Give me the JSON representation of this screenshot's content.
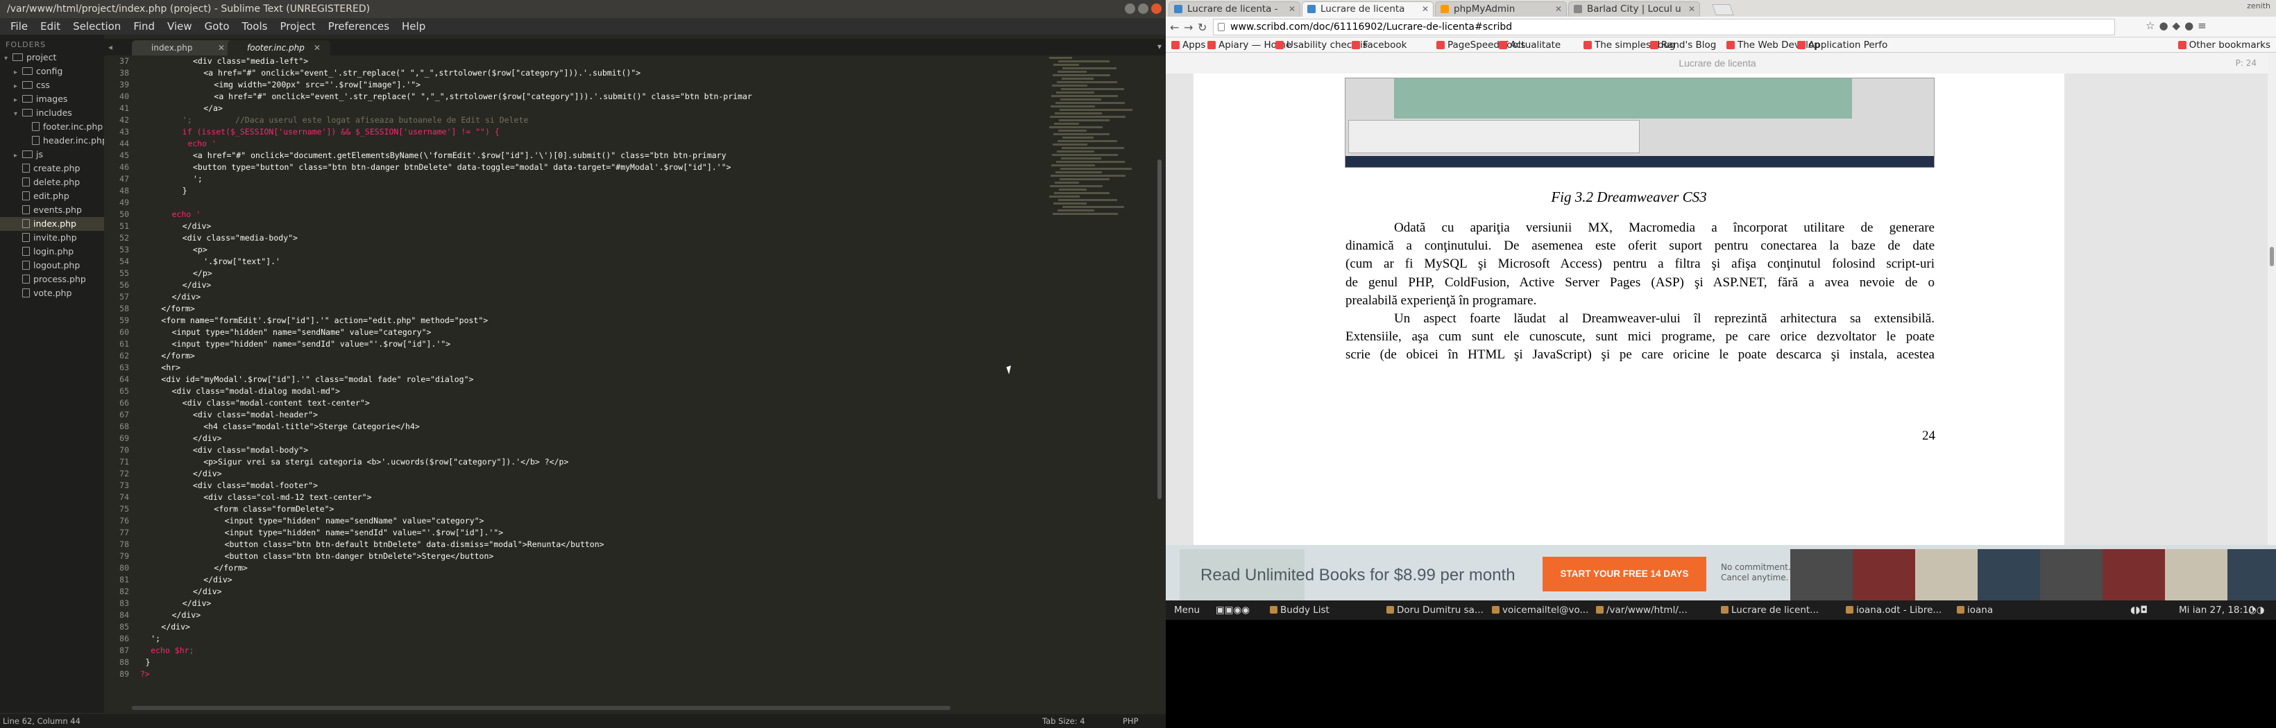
{
  "sublime": {
    "title": "/var/www/html/project/index.php (project) - Sublime Text (UNREGISTERED)",
    "menu": [
      "File",
      "Edit",
      "Selection",
      "Find",
      "View",
      "Goto",
      "Tools",
      "Project",
      "Preferences",
      "Help"
    ],
    "sidebar": {
      "header": "FOLDERS",
      "tree": [
        {
          "label": "project",
          "kind": "folder",
          "depth": 0,
          "open": true
        },
        {
          "label": "config",
          "kind": "folder",
          "depth": 1,
          "open": false
        },
        {
          "label": "css",
          "kind": "folder",
          "depth": 1,
          "open": false
        },
        {
          "label": "images",
          "kind": "folder",
          "depth": 1,
          "open": false
        },
        {
          "label": "includes",
          "kind": "folder",
          "depth": 1,
          "open": true
        },
        {
          "label": "footer.inc.php",
          "kind": "file",
          "depth": 2
        },
        {
          "label": "header.inc.php",
          "kind": "file",
          "depth": 2
        },
        {
          "label": "js",
          "kind": "folder",
          "depth": 1,
          "open": false
        },
        {
          "label": "create.php",
          "kind": "file",
          "depth": 1
        },
        {
          "label": "delete.php",
          "kind": "file",
          "depth": 1
        },
        {
          "label": "edit.php",
          "kind": "file",
          "depth": 1
        },
        {
          "label": "events.php",
          "kind": "file",
          "depth": 1
        },
        {
          "label": "index.php",
          "kind": "file",
          "depth": 1,
          "active": true
        },
        {
          "label": "invite.php",
          "kind": "file",
          "depth": 1
        },
        {
          "label": "login.php",
          "kind": "file",
          "depth": 1
        },
        {
          "label": "logout.php",
          "kind": "file",
          "depth": 1
        },
        {
          "label": "process.php",
          "kind": "file",
          "depth": 1
        },
        {
          "label": "vote.php",
          "kind": "file",
          "depth": 1
        }
      ]
    },
    "tabs": [
      {
        "label": "index.php",
        "active": false
      },
      {
        "label": "footer.inc.php",
        "active": true
      }
    ],
    "code": [
      {
        "n": "37",
        "indent": 10,
        "t": "<div class=\"media-left\">",
        "c": "tag"
      },
      {
        "n": "38",
        "indent": 12,
        "t": "<a href=\"#\" onclick=\"event_'.str_replace(\" \",\"_\",strtolower($row[\"category\"])).'.submit()\">",
        "c": "tag"
      },
      {
        "n": "39",
        "indent": 14,
        "t": "<img width=\"200px\" src=\"'.$row[\"image\"].'\">",
        "c": "tag"
      },
      {
        "n": "40",
        "indent": 14,
        "t": "<a href=\"#\" onclick=\"event_'.str_replace(\" \",\"_\",strtolower($row[\"category\"])).'.submit()\" class=\"btn btn-primar",
        "c": "tag"
      },
      {
        "n": "41",
        "indent": 12,
        "t": "</a>",
        "c": "tag"
      },
      {
        "n": "42",
        "indent": 8,
        "t": "';         //Daca userul este logat afiseaza butoanele de Edit si Delete",
        "c": "cmt"
      },
      {
        "n": "43",
        "indent": 8,
        "t": "if (isset($_SESSION['username']) && $_SESSION['username'] != \"\") {",
        "c": "kw"
      },
      {
        "n": "44",
        "indent": 9,
        "t": "echo '",
        "c": "kw"
      },
      {
        "n": "45",
        "indent": 10,
        "t": "<a href=\"#\" onclick=\"document.getElementsByName(\\'formEdit'.$row[\"id\"].'\\')[0].submit()\" class=\"btn btn-primary",
        "c": "tag"
      },
      {
        "n": "46",
        "indent": 10,
        "t": "<button type=\"button\" class=\"btn btn-danger btnDelete\" data-toggle=\"modal\" data-target=\"#myModal'.$row[\"id\"].'\">",
        "c": "tag"
      },
      {
        "n": "47",
        "indent": 10,
        "t": "';",
        "c": "plain"
      },
      {
        "n": "48",
        "indent": 8,
        "t": "}",
        "c": "plain"
      },
      {
        "n": "49",
        "indent": 0,
        "t": "",
        "c": "plain"
      },
      {
        "n": "50",
        "indent": 6,
        "t": "echo '",
        "c": "kw"
      },
      {
        "n": "51",
        "indent": 8,
        "t": "</div>",
        "c": "tag"
      },
      {
        "n": "52",
        "indent": 8,
        "t": "<div class=\"media-body\">",
        "c": "tag"
      },
      {
        "n": "53",
        "indent": 10,
        "t": "<p>",
        "c": "tag"
      },
      {
        "n": "54",
        "indent": 12,
        "t": "'.$row[\"text\"].'",
        "c": "plain"
      },
      {
        "n": "55",
        "indent": 10,
        "t": "</p>",
        "c": "tag"
      },
      {
        "n": "56",
        "indent": 8,
        "t": "</div>",
        "c": "tag"
      },
      {
        "n": "57",
        "indent": 6,
        "t": "</div>",
        "c": "tag"
      },
      {
        "n": "58",
        "indent": 4,
        "t": "</form>",
        "c": "tag"
      },
      {
        "n": "59",
        "indent": 4,
        "t": "<form name=\"formEdit'.$row[\"id\"].'\" action=\"edit.php\" method=\"post\">",
        "c": "tag"
      },
      {
        "n": "60",
        "indent": 6,
        "t": "<input type=\"hidden\" name=\"sendName\" value=\"category\">",
        "c": "tag"
      },
      {
        "n": "61",
        "indent": 6,
        "t": "<input type=\"hidden\" name=\"sendId\" value=\"'.$row[\"id\"].'\">",
        "c": "tag"
      },
      {
        "n": "62",
        "indent": 4,
        "t": "</form>",
        "c": "tag"
      },
      {
        "n": "63",
        "indent": 4,
        "t": "<hr>",
        "c": "tag"
      },
      {
        "n": "64",
        "indent": 4,
        "t": "<div id=\"myModal'.$row[\"id\"].'\" class=\"modal fade\" role=\"dialog\">",
        "c": "tag"
      },
      {
        "n": "65",
        "indent": 6,
        "t": "<div class=\"modal-dialog modal-md\">",
        "c": "tag"
      },
      {
        "n": "66",
        "indent": 8,
        "t": "<div class=\"modal-content text-center\">",
        "c": "tag"
      },
      {
        "n": "67",
        "indent": 10,
        "t": "<div class=\"modal-header\">",
        "c": "tag"
      },
      {
        "n": "68",
        "indent": 12,
        "t": "<h4 class=\"modal-title\">Sterge Categorie</h4>",
        "c": "tag"
      },
      {
        "n": "69",
        "indent": 10,
        "t": "</div>",
        "c": "tag"
      },
      {
        "n": "70",
        "indent": 10,
        "t": "<div class=\"modal-body\">",
        "c": "tag"
      },
      {
        "n": "71",
        "indent": 12,
        "t": "<p>Sigur vrei sa stergi categoria <b>'.ucwords($row[\"category\"]).'</b> ?</p>",
        "c": "tag"
      },
      {
        "n": "72",
        "indent": 10,
        "t": "</div>",
        "c": "tag"
      },
      {
        "n": "73",
        "indent": 10,
        "t": "<div class=\"modal-footer\">",
        "c": "tag"
      },
      {
        "n": "74",
        "indent": 12,
        "t": "<div class=\"col-md-12 text-center\">",
        "c": "tag"
      },
      {
        "n": "75",
        "indent": 14,
        "t": "<form class=\"formDelete\">",
        "c": "tag"
      },
      {
        "n": "76",
        "indent": 16,
        "t": "<input type=\"hidden\" name=\"sendName\" value=\"category\">",
        "c": "tag"
      },
      {
        "n": "77",
        "indent": 16,
        "t": "<input type=\"hidden\" name=\"sendId\" value=\"'.$row[\"id\"].'\">",
        "c": "tag"
      },
      {
        "n": "78",
        "indent": 16,
        "t": "<button class=\"btn btn-default btnDelete\" data-dismiss=\"modal\">Renunta</button>",
        "c": "tag"
      },
      {
        "n": "79",
        "indent": 16,
        "t": "<button class=\"btn btn-danger btnDelete\">Sterge</button>",
        "c": "tag"
      },
      {
        "n": "80",
        "indent": 14,
        "t": "</form>",
        "c": "tag"
      },
      {
        "n": "81",
        "indent": 12,
        "t": "</div>",
        "c": "tag"
      },
      {
        "n": "82",
        "indent": 10,
        "t": "</div>",
        "c": "tag"
      },
      {
        "n": "83",
        "indent": 8,
        "t": "</div>",
        "c": "tag"
      },
      {
        "n": "84",
        "indent": 6,
        "t": "</div>",
        "c": "tag"
      },
      {
        "n": "85",
        "indent": 4,
        "t": "</div>",
        "c": "tag"
      },
      {
        "n": "86",
        "indent": 2,
        "t": "';",
        "c": "plain"
      },
      {
        "n": "87",
        "indent": 2,
        "t": "echo $hr;",
        "c": "kw"
      },
      {
        "n": "88",
        "indent": 1,
        "t": "}",
        "c": "plain"
      },
      {
        "n": "89",
        "indent": 0,
        "t": "?>",
        "c": "kw"
      }
    ],
    "status": {
      "position": "Line 62, Column 44",
      "tab_size": "Tab Size: 4",
      "syntax": "PHP"
    },
    "colors": {
      "tag": "#f8f8f2",
      "kw": "#f92672",
      "cmt": "#75715e",
      "str": "#e6db74",
      "plain": "#f8f8f2"
    }
  },
  "chrome": {
    "tabs": [
      {
        "label": "Lucrare de licenta - ",
        "active": false
      },
      {
        "label": "Lucrare de licenta",
        "active": true
      },
      {
        "label": "phpMyAdmin",
        "active": false
      },
      {
        "label": "Barlad City | Locul u",
        "active": false
      }
    ],
    "top_right": "zenith",
    "url": "www.scribd.com/doc/61116902/Lucrare-de-licenta#scribd",
    "bookmarks": [
      "Apps",
      "Apiary — Home",
      "Usability checklis",
      "Facebook",
      "PageSpeed Tools",
      "Actualitate",
      "The simplest bug",
      "Rand's Blog",
      "The Web Develop",
      "Application Perfo",
      "Other bookmarks"
    ],
    "doc": {
      "header": "Lucrare de licenta",
      "page_indicator": "P: 24",
      "caption": "Fig 3.2 Dreamweaver CS3",
      "para1": [
        "Odată cu apariţia versiunii MX, Macromedia a încorporat utilitare de generare",
        "dinamică a conţinutului. De asemenea este oferit suport pentru conectarea la baze de date",
        "(cum ar fi MySQL şi Microsoft Access) pentru a filtra şi afişa conţinutul folosind script-uri",
        "de genul PHP, ColdFusion, Active Server Pages (ASP) şi ASP.NET, fără a avea nevoie de o",
        "prealabilă experienţă în programare."
      ],
      "para2": [
        "Un aspect foarte lăudat al Dreamweaver-ului îl reprezintă arhitectura sa extensibilă.",
        "Extensiile, aşa cum sunt ele cunoscute, sunt mici programe, pe care orice dezvoltator le poate",
        "scrie (de obicei în HTML şi JavaScript) şi pe care oricine le poate descarca şi instala, acestea"
      ],
      "page_number": "24"
    },
    "banner": {
      "title": "Read Unlimited Books for $8.99 per month",
      "cta": "START YOUR FREE 14 DAYS",
      "note1": "No commitment.",
      "note2": "Cancel anytime."
    }
  },
  "taskbar": {
    "menu": "Menu",
    "items": [
      "Buddy List",
      "Doru Dumitru sa...",
      "voicemailtel@vo...",
      "/var/www/html/...",
      "Lucrare de licent...",
      "ioana.odt - Libre...",
      "ioana"
    ],
    "clock": "Mi ian 27, 18:10"
  }
}
